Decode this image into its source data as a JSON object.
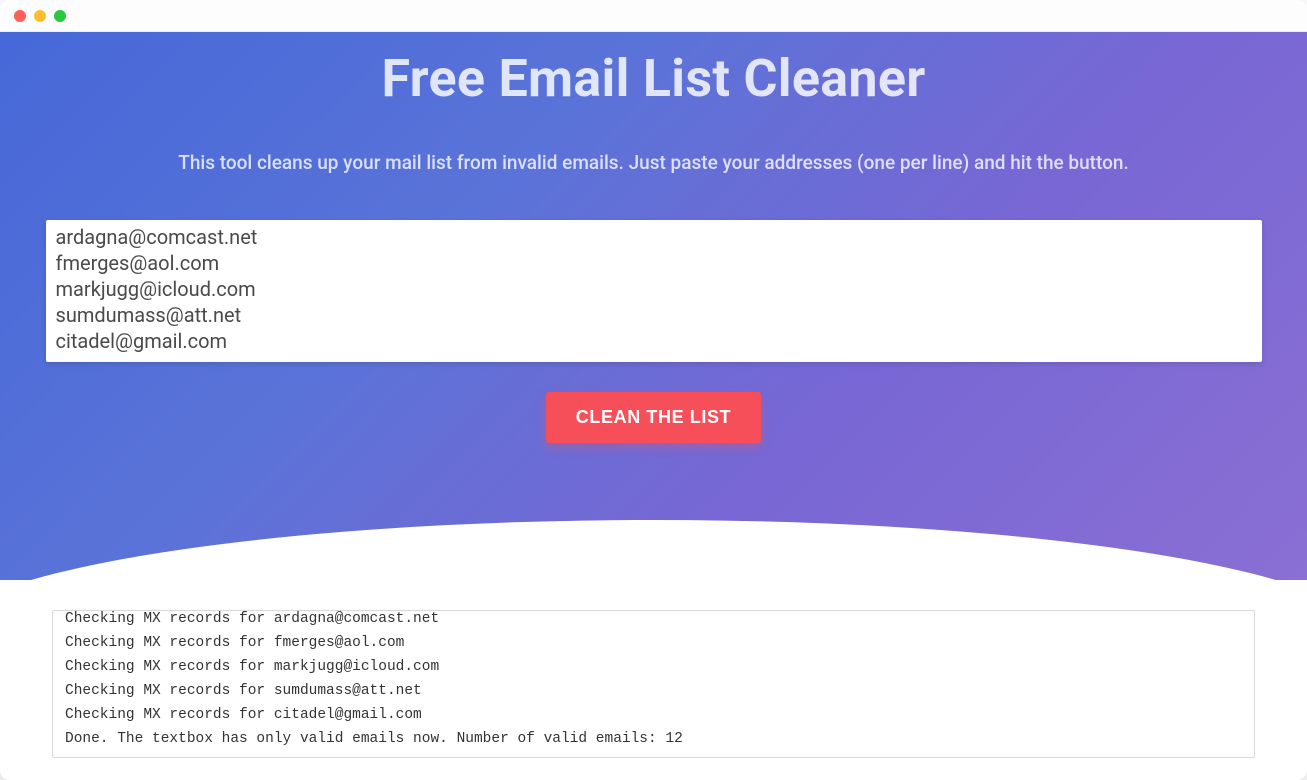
{
  "window": {
    "traffic": {
      "close": "close",
      "minimize": "minimize",
      "zoom": "zoom"
    }
  },
  "hero": {
    "title": "Free Email List Cleaner",
    "subtitle": "This tool cleans up your mail list from invalid emails. Just paste your addresses (one per line) and hit the button.",
    "button_label": "CLEAN THE LIST"
  },
  "email_input": {
    "value": "ardagna@comcast.net\nfmerges@aol.com\nmarkjugg@icloud.com\nsumdumass@att.net\ncitadel@gmail.com"
  },
  "log_output": {
    "value": "Checking MX records for ardagna@comcast.net\nChecking MX records for fmerges@aol.com\nChecking MX records for markjugg@icloud.com\nChecking MX records for sumdumass@att.net\nChecking MX records for citadel@gmail.com\nDone. The textbox has only valid emails now. Number of valid emails: 12"
  },
  "colors": {
    "accent": "#f64f59",
    "hero_gradient_start": "#4668d8",
    "hero_gradient_end": "#8a6fd4"
  }
}
